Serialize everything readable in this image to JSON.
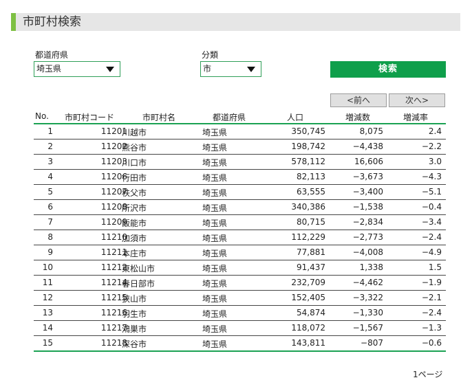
{
  "page": {
    "title": "市町村検索"
  },
  "filters": {
    "prefecture_label": "都道府県",
    "prefecture_value": "埼玉県",
    "category_label": "分類",
    "category_value": "市",
    "search_label": "検索"
  },
  "pager": {
    "prev_label": "<前へ",
    "next_label": "次へ>",
    "page_text": "1ページ"
  },
  "table": {
    "headers": {
      "no": "No.",
      "code": "市町村コード",
      "name": "市町村名",
      "pref": "都道府県",
      "pop": "人口",
      "delta": "増減数",
      "rate": "増減率"
    },
    "rows": [
      {
        "no": "1",
        "code": "11201",
        "name": "川越市",
        "pref": "埼玉県",
        "pop": "350,745",
        "delta": "8,075",
        "rate": "2.4"
      },
      {
        "no": "2",
        "code": "11202",
        "name": "熊谷市",
        "pref": "埼玉県",
        "pop": "198,742",
        "delta": "−4,438",
        "rate": "−2.2"
      },
      {
        "no": "3",
        "code": "11203",
        "name": "川口市",
        "pref": "埼玉県",
        "pop": "578,112",
        "delta": "16,606",
        "rate": "3.0"
      },
      {
        "no": "4",
        "code": "11206",
        "name": "行田市",
        "pref": "埼玉県",
        "pop": "82,113",
        "delta": "−3,673",
        "rate": "−4.3"
      },
      {
        "no": "5",
        "code": "11207",
        "name": "秩父市",
        "pref": "埼玉県",
        "pop": "63,555",
        "delta": "−3,400",
        "rate": "−5.1"
      },
      {
        "no": "6",
        "code": "11208",
        "name": "所沢市",
        "pref": "埼玉県",
        "pop": "340,386",
        "delta": "−1,538",
        "rate": "−0.4"
      },
      {
        "no": "7",
        "code": "11209",
        "name": "飯能市",
        "pref": "埼玉県",
        "pop": "80,715",
        "delta": "−2,834",
        "rate": "−3.4"
      },
      {
        "no": "8",
        "code": "11210",
        "name": "加須市",
        "pref": "埼玉県",
        "pop": "112,229",
        "delta": "−2,773",
        "rate": "−2.4"
      },
      {
        "no": "9",
        "code": "11211",
        "name": "本庄市",
        "pref": "埼玉県",
        "pop": "77,881",
        "delta": "−4,008",
        "rate": "−4.9"
      },
      {
        "no": "10",
        "code": "11212",
        "name": "東松山市",
        "pref": "埼玉県",
        "pop": "91,437",
        "delta": "1,338",
        "rate": "1.5"
      },
      {
        "no": "11",
        "code": "11214",
        "name": "春日部市",
        "pref": "埼玉県",
        "pop": "232,709",
        "delta": "−4,462",
        "rate": "−1.9"
      },
      {
        "no": "12",
        "code": "11215",
        "name": "狭山市",
        "pref": "埼玉県",
        "pop": "152,405",
        "delta": "−3,322",
        "rate": "−2.1"
      },
      {
        "no": "13",
        "code": "11216",
        "name": "羽生市",
        "pref": "埼玉県",
        "pop": "54,874",
        "delta": "−1,330",
        "rate": "−2.4"
      },
      {
        "no": "14",
        "code": "11217",
        "name": "鴻巣市",
        "pref": "埼玉県",
        "pop": "118,072",
        "delta": "−1,567",
        "rate": "−1.3"
      },
      {
        "no": "15",
        "code": "11218",
        "name": "深谷市",
        "pref": "埼玉県",
        "pop": "143,811",
        "delta": "−807",
        "rate": "−0.6"
      }
    ]
  }
}
